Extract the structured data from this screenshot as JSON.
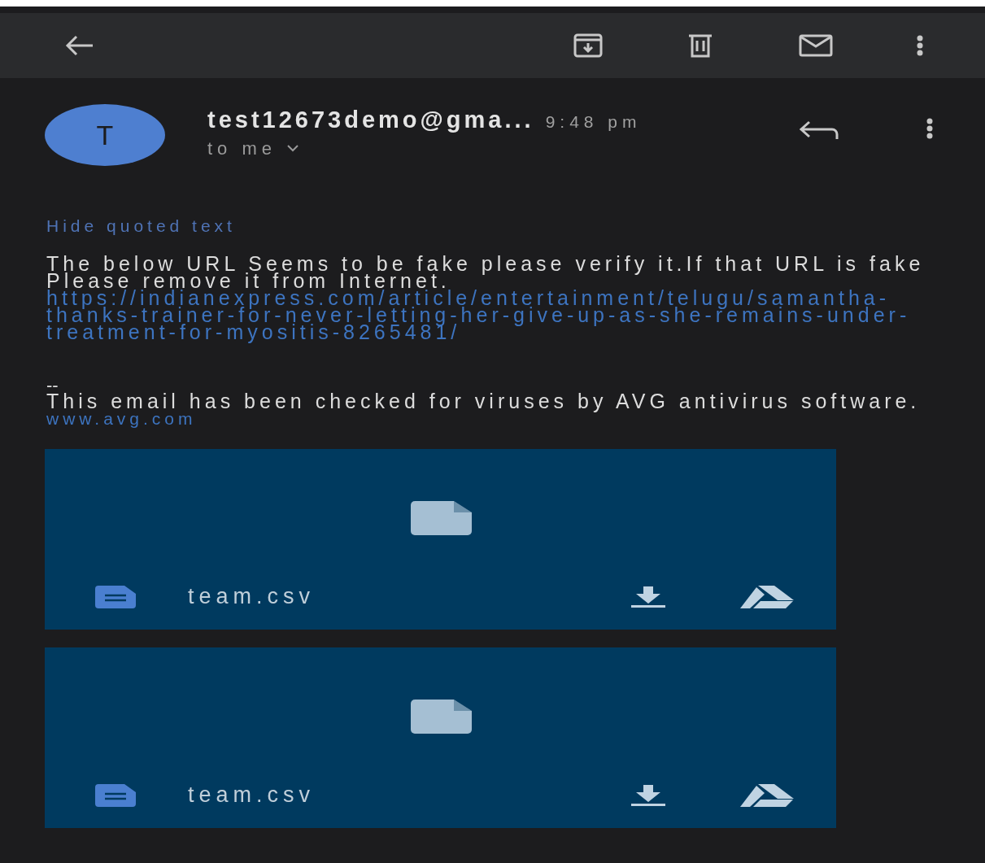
{
  "message": {
    "avatar_letter": "T",
    "sender": "test12673demo@gma...",
    "time": "9:48 pm",
    "recipient": "to me"
  },
  "quoted_toggle": "Hide quoted text",
  "body": {
    "text": "The below URL Seems to be fake please verify it.If that URL is fake Please remove it from Internet.",
    "url": "https://indianexpress.com/article/entertainment/telugu/samantha-thanks-trainer-for-never-letting-her-give-up-as-she-remains-under-treatment-for-myositis-8265481/",
    "separator": "--",
    "footer": "This email has been checked for viruses by AVG antivirus software.",
    "footer_link": "www.avg.com"
  },
  "attachments": [
    {
      "name": "team.csv"
    },
    {
      "name": "team.csv"
    }
  ]
}
